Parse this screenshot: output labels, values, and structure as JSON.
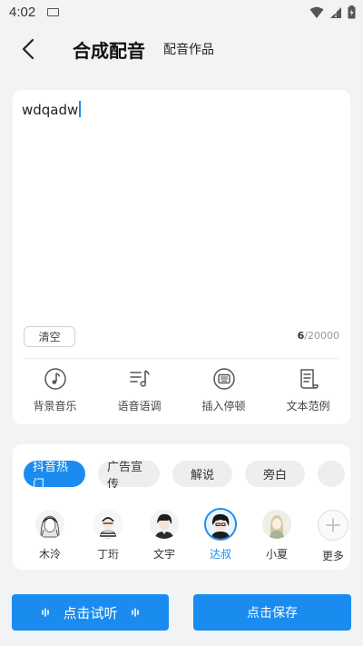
{
  "status": {
    "time": "4:02"
  },
  "header": {
    "title": "合成配音",
    "works_label": "配音作品"
  },
  "editor": {
    "text": "wdqadw",
    "clear_label": "清空",
    "count": "6",
    "max": "/20000"
  },
  "tools": [
    {
      "label": "背景音乐",
      "icon": "music-note-icon"
    },
    {
      "label": "语音语调",
      "icon": "tone-icon"
    },
    {
      "label": "插入停顿",
      "icon": "pause-insert-icon"
    },
    {
      "label": "文本范例",
      "icon": "text-sample-icon"
    }
  ],
  "categories": [
    {
      "label": "抖音热门",
      "active": true
    },
    {
      "label": "广告宣传",
      "active": false
    },
    {
      "label": "解说",
      "active": false
    },
    {
      "label": "旁白",
      "active": false
    }
  ],
  "voices": [
    {
      "name": "木泠",
      "selected": false
    },
    {
      "name": "丁珩",
      "selected": false
    },
    {
      "name": "文宇",
      "selected": false
    },
    {
      "name": "达叔",
      "selected": true
    },
    {
      "name": "小夏",
      "selected": false
    }
  ],
  "more_label": "更多",
  "buttons": {
    "listen_label": "点击试听",
    "save_label": "点击保存"
  },
  "colors": {
    "accent": "#1a8cf0",
    "background": "#f2f3f5"
  }
}
